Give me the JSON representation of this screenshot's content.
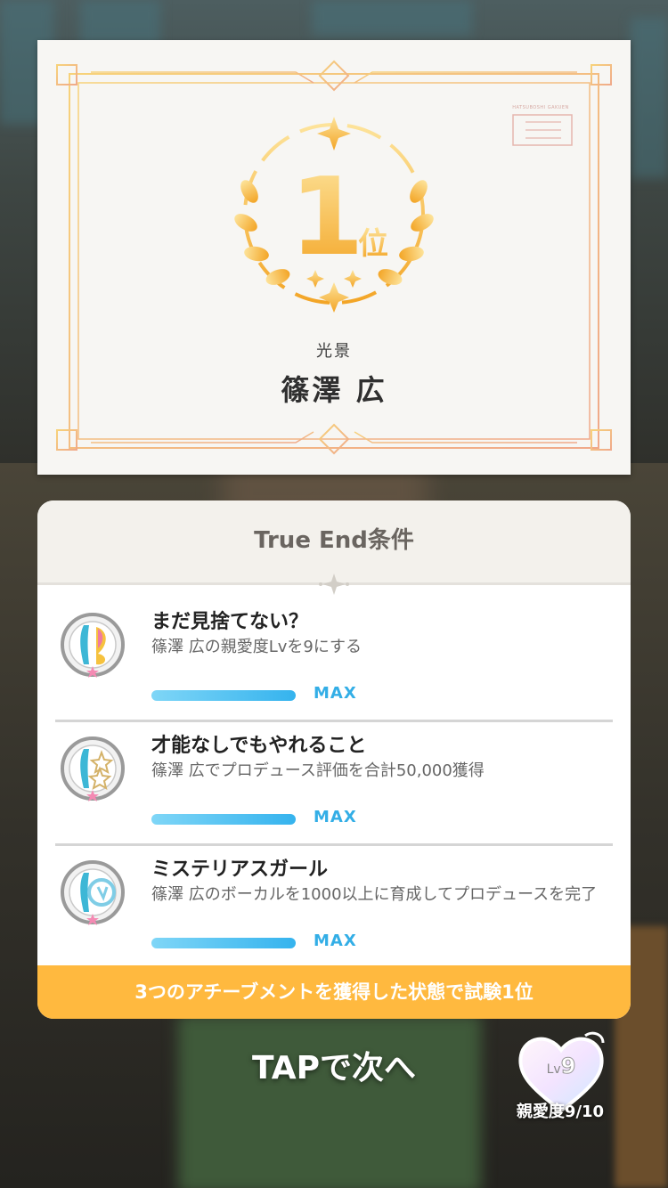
{
  "certificate": {
    "rank_number": "1",
    "rank_suffix": "位",
    "unit_name": "光景",
    "idol_name": "篠澤 広",
    "brand_text": "HATSUBOSHI GAKUEN"
  },
  "true_end": {
    "title": "True End条件",
    "items": [
      {
        "icon": "achievement-badge-heart",
        "title": "まだ見捨てない？",
        "desc": "篠澤 広の親愛度Lvを9にする",
        "status": "MAX",
        "progress": 1.0
      },
      {
        "icon": "achievement-badge-stars",
        "title": "才能なしでもやれること",
        "desc": "篠澤 広でプロデュース評価を合計50,000獲得",
        "status": "MAX",
        "progress": 1.0
      },
      {
        "icon": "achievement-badge-vocal",
        "title": "ミステリアスガール",
        "desc": "篠澤 広のボーカルを1000以上に育成してプロデュースを完了",
        "status": "MAX",
        "progress": 1.0
      }
    ],
    "footer": "3つのアチーブメントを獲得した状態で試験1位"
  },
  "tap_label": "TAPで次へ",
  "affinity": {
    "lv_label": "Lv",
    "level": "9",
    "text": "親愛度9/10"
  },
  "colors": {
    "gold": "#f5b43a",
    "accent_blue": "#33aee6",
    "footer_orange": "#ffb93f"
  }
}
